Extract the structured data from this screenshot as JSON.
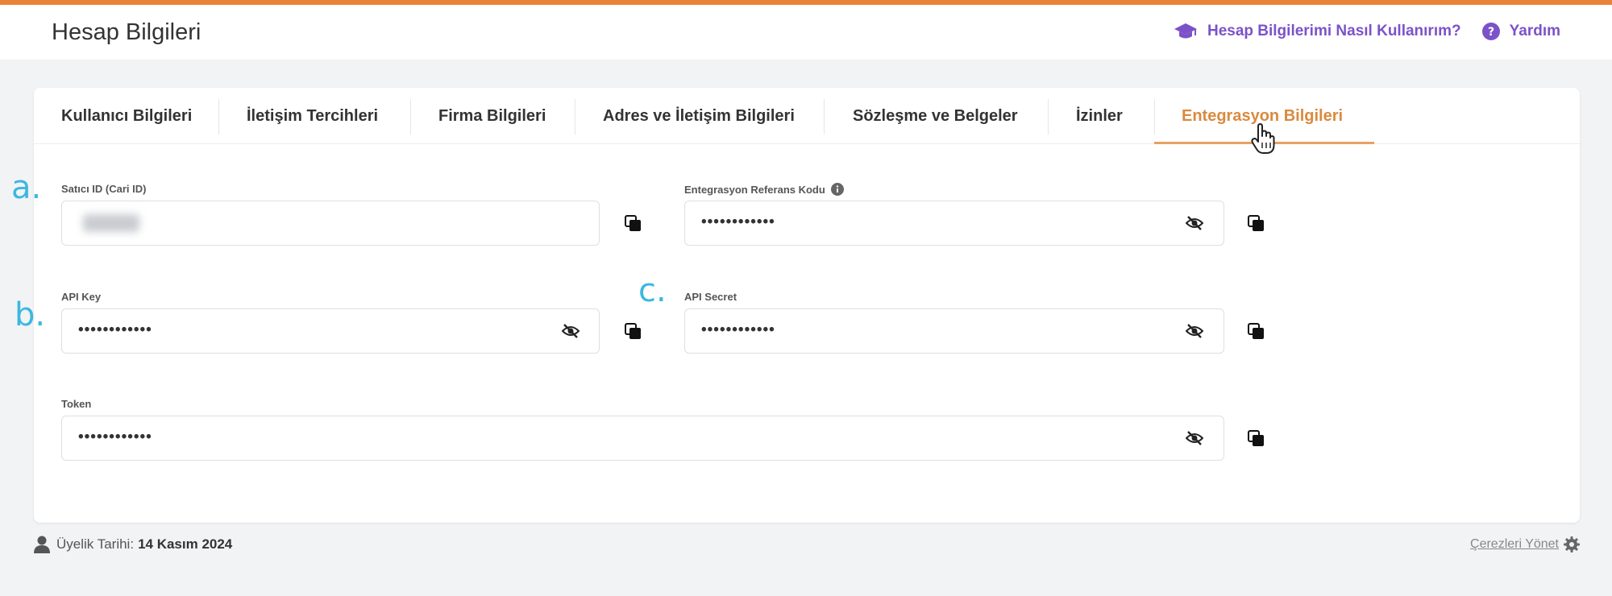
{
  "header": {
    "title": "Hesap Bilgileri",
    "help_guide_label": "Hesap Bilgilerimi Nasıl Kullanırım?",
    "help_label": "Yardım"
  },
  "tabs": [
    {
      "label": "Kullanıcı Bilgileri"
    },
    {
      "label": "İletişim Tercihleri"
    },
    {
      "label": "Firma Bilgileri"
    },
    {
      "label": "Adres ve İletişim Bilgileri"
    },
    {
      "label": "Sözleşme ve Belgeler"
    },
    {
      "label": "İzinler"
    },
    {
      "label": "Entegrasyon Bilgileri",
      "active": true
    }
  ],
  "fields": {
    "seller_id": {
      "label": "Satıcı ID (Cari ID)",
      "value_hidden": true
    },
    "integration_ref": {
      "label": "Entegrasyon Referans Kodu",
      "value": "••••••••••••"
    },
    "api_key": {
      "label": "API Key",
      "value": "••••••••••••"
    },
    "api_secret": {
      "label": "API Secret",
      "value": "••••••••••••"
    },
    "token": {
      "label": "Token",
      "value": "••••••••••••"
    }
  },
  "annotations": {
    "a": "a.",
    "b": "b.",
    "c": "c."
  },
  "footer": {
    "membership_label": "Üyelik Tarihi:",
    "membership_date": "14 Kasım 2024",
    "cookies_label": "Çerezleri Yönet"
  },
  "colors": {
    "accent_orange": "#e8823a",
    "active_tab": "#d98a3f",
    "link_purple": "#7b52c9",
    "annotation_blue": "#3bb8e0"
  }
}
